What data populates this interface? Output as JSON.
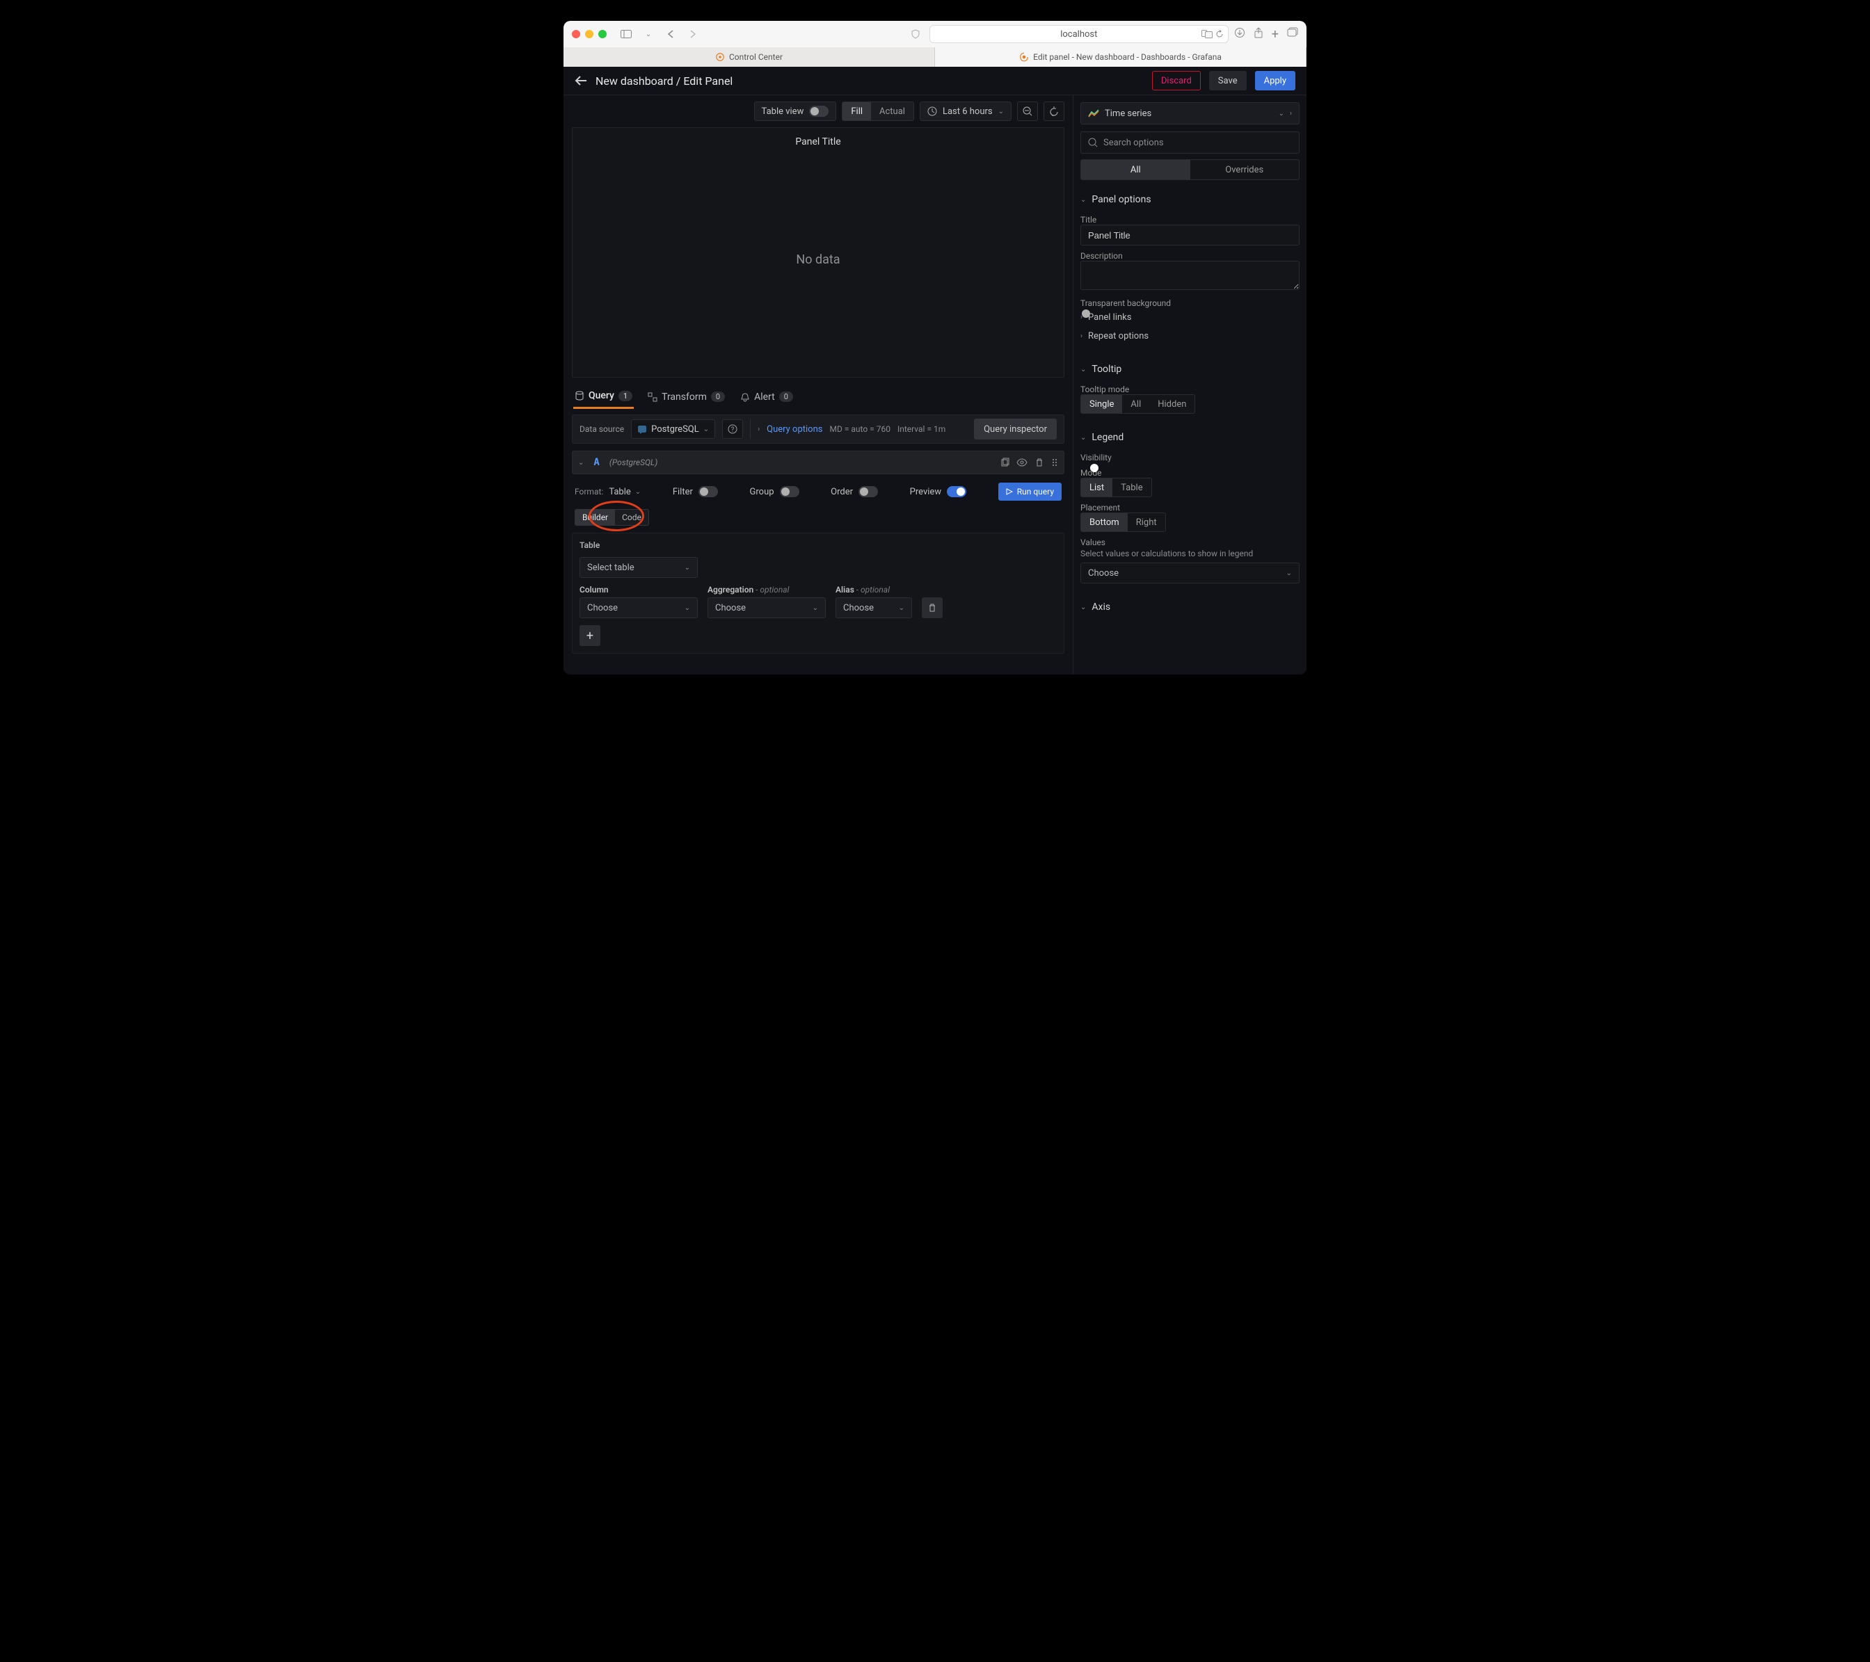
{
  "browser": {
    "url": "localhost",
    "tabs": [
      {
        "label": "Control Center"
      },
      {
        "label": "Edit panel - New dashboard - Dashboards - Grafana"
      }
    ]
  },
  "header": {
    "breadcrumb": "New dashboard / Edit Panel",
    "discard": "Discard",
    "save": "Save",
    "apply": "Apply"
  },
  "toolbar": {
    "table_view_label": "Table view",
    "fill": "Fill",
    "actual": "Actual",
    "time_range": "Last 6 hours"
  },
  "panel": {
    "title": "Panel Title",
    "no_data": "No data"
  },
  "editor_tabs": {
    "query": "Query",
    "query_count": "1",
    "transform": "Transform",
    "transform_count": "0",
    "alert": "Alert",
    "alert_count": "0"
  },
  "query_bar": {
    "ds_label": "Data source",
    "ds_name": "PostgreSQL",
    "query_options": "Query options",
    "md": "MD = auto = 760",
    "interval": "Interval = 1m",
    "inspector": "Query inspector"
  },
  "query_a": {
    "letter": "A",
    "ds_parenthetical": "(PostgreSQL)",
    "format_label": "Format:",
    "format_value": "Table",
    "filter": "Filter",
    "group": "Group",
    "order": "Order",
    "preview": "Preview",
    "run": "Run query",
    "builder": "Builder",
    "code": "Code",
    "table_label": "Table",
    "table_placeholder": "Select table",
    "column_label": "Column",
    "aggregation_label": "Aggregation",
    "alias_label": "Alias",
    "optional": " - optional",
    "choose": "Choose"
  },
  "right": {
    "viz": "Time series",
    "search_placeholder": "Search options",
    "tab_all": "All",
    "tab_overrides": "Overrides",
    "panel_options": {
      "heading": "Panel options",
      "title_label": "Title",
      "title_value": "Panel Title",
      "description_label": "Description",
      "transparent": "Transparent background",
      "panel_links": "Panel links",
      "repeat": "Repeat options"
    },
    "tooltip": {
      "heading": "Tooltip",
      "mode_label": "Tooltip mode",
      "single": "Single",
      "all": "All",
      "hidden": "Hidden"
    },
    "legend": {
      "heading": "Legend",
      "visibility": "Visibility",
      "mode": "Mode",
      "list": "List",
      "table": "Table",
      "placement": "Placement",
      "bottom": "Bottom",
      "right": "Right",
      "values": "Values",
      "values_desc": "Select values or calculations to show in legend",
      "choose": "Choose"
    },
    "axis": {
      "heading": "Axis"
    }
  }
}
